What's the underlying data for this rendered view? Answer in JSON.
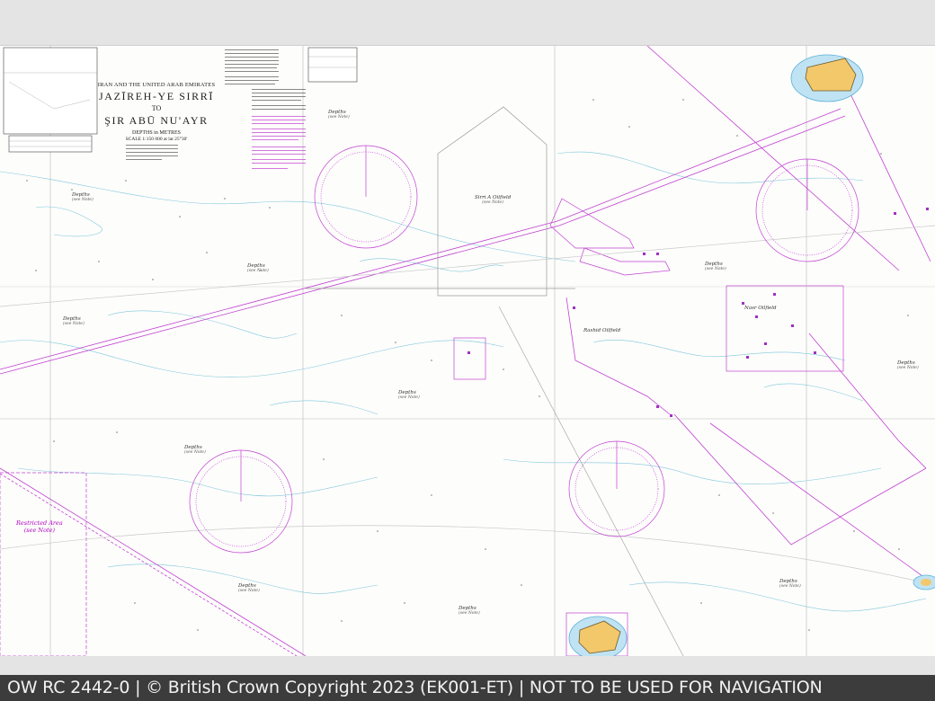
{
  "chart": {
    "title_sup": "IRAN AND THE UNITED ARAB EMIRATES",
    "title_main": "JAZĪREH-YE SIRRĪ",
    "title_to": "TO",
    "title_end": "ŞIR ABŪ NU'AYR",
    "depths_note": "DEPTHS in METRES",
    "scale_note": "SCALE 1:150 000 at lat 25°30'"
  },
  "area_labels": [
    {
      "id": "depths-nw",
      "text": "Depths",
      "sub": "(see Note)"
    },
    {
      "id": "depths-n",
      "text": "Depths",
      "sub": "(see Note)"
    },
    {
      "id": "depths-w",
      "text": "Depths",
      "sub": "(see Note)"
    },
    {
      "id": "depths-mid",
      "text": "Depths",
      "sub": "(see Note)"
    },
    {
      "id": "depths-c",
      "text": "Depths",
      "sub": "(see Note)"
    },
    {
      "id": "depths-ne",
      "text": "Depths",
      "sub": "(see Note)"
    },
    {
      "id": "depths-e",
      "text": "Depths",
      "sub": "(see Note)"
    },
    {
      "id": "depths-sw",
      "text": "Depths",
      "sub": "(see Note)"
    },
    {
      "id": "depths-s",
      "text": "Depths",
      "sub": "(see Note)"
    },
    {
      "id": "depths-se",
      "text": "Depths",
      "sub": "(see Note)"
    },
    {
      "id": "depths-bottom",
      "text": "Depths",
      "sub": "(see Note)"
    },
    {
      "id": "sirri-oilfield",
      "text": "Sirri A Oilfield",
      "sub": "(see Note)"
    },
    {
      "id": "nasr-oilfield",
      "text": "Nasr Oilfield",
      "sub": ""
    },
    {
      "id": "rashid-oilfield",
      "text": "Rashid Oilfield",
      "sub": ""
    }
  ],
  "restricted": {
    "line1": "Restricted Area",
    "line2": "(see Note)"
  },
  "footer": {
    "text": "OW RC 2442-0 | © British Crown Copyright 2023 (EK001-ET) | NOT TO BE USED FOR NAVIGATION"
  }
}
